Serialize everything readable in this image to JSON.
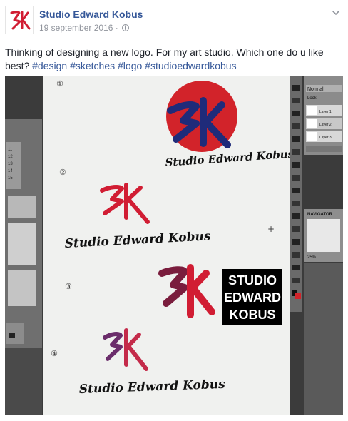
{
  "page": {
    "name": "Studio Edward Kobus",
    "date": "19 september 2016",
    "separator": "·"
  },
  "post": {
    "text": "Thinking of designing a new logo. For my art studio. Which one do u like best?",
    "hashtags": [
      "#design",
      "#sketches",
      "#logo",
      "#studioedwardkobus"
    ]
  },
  "photo": {
    "options": [
      {
        "number": "①",
        "signature": "Studio Edward Kobus"
      },
      {
        "number": "②",
        "signature": "Studio Edward Kobus"
      },
      {
        "number": "③",
        "box_lines": [
          "STUDIO",
          "EDWARD",
          "KOBUS"
        ]
      },
      {
        "number": "④",
        "signature": "Studio Edward Kobus"
      }
    ],
    "layers_panel": {
      "mode": "Normal",
      "lock": "Lock:",
      "layers": [
        "Layer 1",
        "Layer 2",
        "Layer 3"
      ]
    },
    "navigator": {
      "title": "NAVIGATOR",
      "zoom": "25%"
    },
    "left_panel_numbers": [
      "11",
      "12",
      "13",
      "14",
      "15"
    ],
    "colors": {
      "red_circle": "#d2232a",
      "navy": "#1f2b7a",
      "logo_red": "#d11d33"
    }
  }
}
